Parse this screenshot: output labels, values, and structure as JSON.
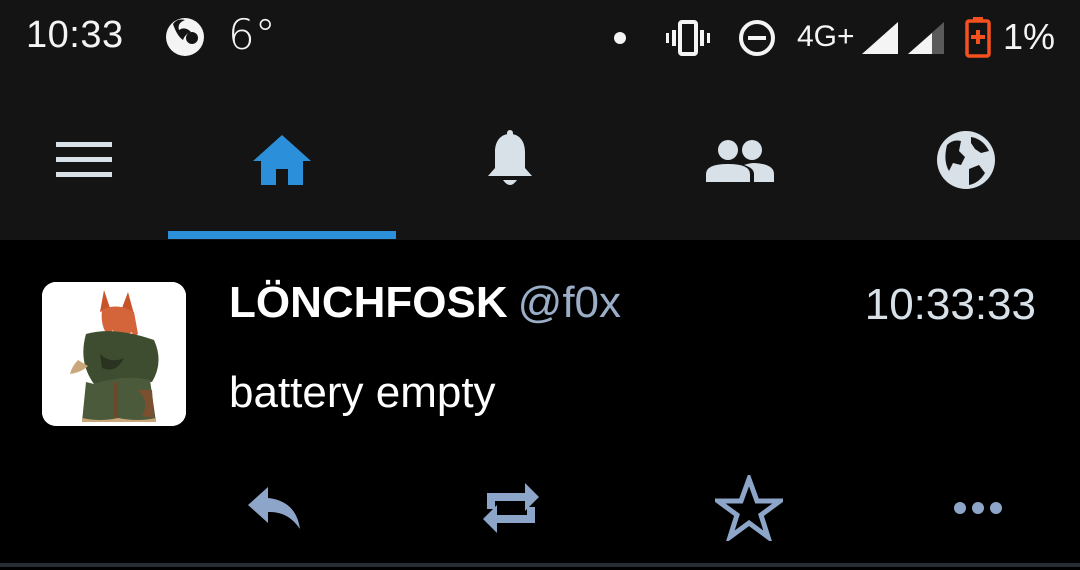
{
  "status_bar": {
    "time": "10:33",
    "temperature": "6°",
    "network": "4G+",
    "battery_percent": "1%",
    "icons": [
      "firefox-icon",
      "notification-dot-icon",
      "vibrate-icon",
      "do-not-disturb-icon",
      "signal-icon",
      "signal-icon",
      "battery-low-icon"
    ]
  },
  "tabs": [
    {
      "icon": "hamburger-menu-icon",
      "active": false
    },
    {
      "icon": "home-icon",
      "active": true
    },
    {
      "icon": "bell-icon",
      "active": false
    },
    {
      "icon": "people-icon",
      "active": false
    },
    {
      "icon": "globe-icon",
      "active": false
    }
  ],
  "post": {
    "display_name": "LÖNCHFOSK",
    "handle": "@f0x",
    "time": "10:33:33",
    "text": "battery empty",
    "actions": [
      "reply-icon",
      "boost-icon",
      "favourite-icon",
      "more-icon"
    ]
  },
  "colors": {
    "accent": "#2b90d9",
    "icon_muted": "#d9e1e8",
    "handle": "#9baec8",
    "bar_bg": "#141414",
    "battery_warning": "#f4511e"
  }
}
